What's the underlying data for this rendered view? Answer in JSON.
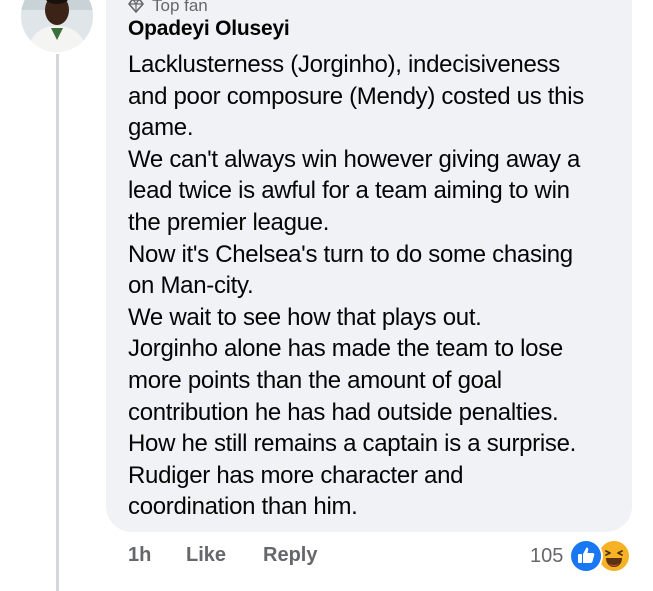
{
  "comment": {
    "badge": "Top fan",
    "author": "Opadeyi Oluseyi",
    "lines": [
      "Lacklusterness (Jorginho), indecisiveness",
      "and poor composure (Mendy) costed us this",
      "game.",
      "We can't always win however giving away a",
      "lead twice is awful for a team aiming to win",
      "the premier league.",
      "Now it's Chelsea's turn to do some chasing",
      "on Man-city.",
      "We wait to see how that plays out.",
      "Jorginho alone has made the team to lose",
      "more points than the amount of goal",
      "contribution he has had outside penalties.",
      "How he still remains a captain is a surprise.",
      "Rudiger has more character and",
      "coordination than him."
    ]
  },
  "actions": {
    "time": "1h",
    "like_label": "Like",
    "reply_label": "Reply"
  },
  "reactions": {
    "count": "105",
    "icons": [
      "like-reaction-icon",
      "haha-reaction-icon"
    ],
    "like_color": "#1877f2",
    "haha_color": "#f7b125"
  },
  "colors": {
    "bubble": "#f0f2f5",
    "text": "#050505",
    "secondary": "#65676b"
  }
}
